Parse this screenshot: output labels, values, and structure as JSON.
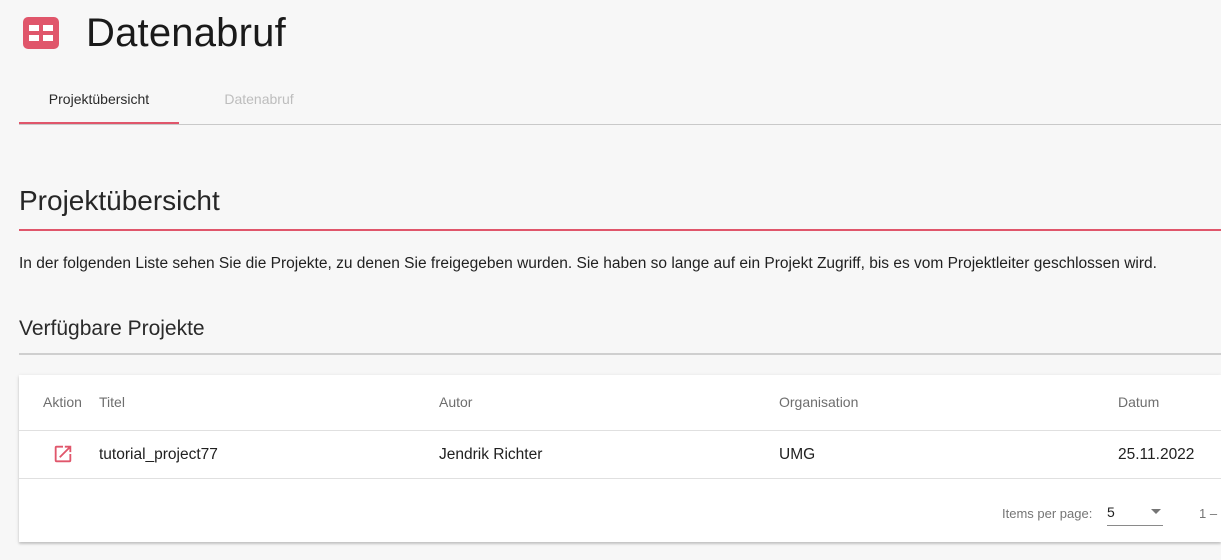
{
  "header": {
    "title": "Datenabruf",
    "icon": "table-grid-icon",
    "accent_color": "#e0566b"
  },
  "tabs": [
    {
      "label": "Projektübersicht",
      "active": true
    },
    {
      "label": "Datenabruf",
      "active": false
    }
  ],
  "section": {
    "heading": "Projektübersicht",
    "description": "In der folgenden Liste sehen Sie die Projekte, zu denen Sie freigegeben wurden. Sie haben so lange auf ein Projekt Zugriff, bis es vom Projektleiter geschlossen wird.",
    "subheading": "Verfügbare Projekte"
  },
  "table": {
    "columns": [
      "Aktion",
      "Titel",
      "Autor",
      "Organisation",
      "Datum"
    ],
    "rows": [
      {
        "action_icon": "open-in-new-icon",
        "titel": "tutorial_project77",
        "autor": "Jendrik Richter",
        "organisation": "UMG",
        "datum": "25.11.2022"
      }
    ]
  },
  "paginator": {
    "items_per_page_label": "Items per page:",
    "items_per_page_value": "5",
    "range_label": "1 –"
  }
}
